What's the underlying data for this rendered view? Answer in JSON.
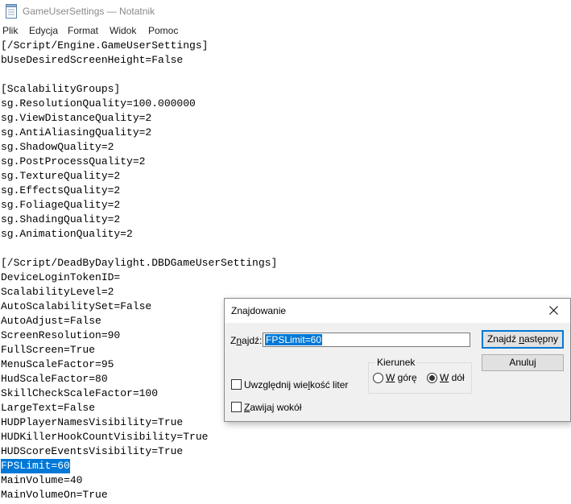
{
  "window": {
    "title": "GameUserSettings — Notatnik",
    "app_icon": "notepad-icon"
  },
  "menu": {
    "items": [
      "Plik",
      "Edycja",
      "Format",
      "Widok",
      "Pomoc"
    ]
  },
  "editor": {
    "lines": [
      "[/Script/Engine.GameUserSettings]",
      "bUseDesiredScreenHeight=False",
      "",
      "[ScalabilityGroups]",
      "sg.ResolutionQuality=100.000000",
      "sg.ViewDistanceQuality=2",
      "sg.AntiAliasingQuality=2",
      "sg.ShadowQuality=2",
      "sg.PostProcessQuality=2",
      "sg.TextureQuality=2",
      "sg.EffectsQuality=2",
      "sg.FoliageQuality=2",
      "sg.ShadingQuality=2",
      "sg.AnimationQuality=2",
      "",
      "[/Script/DeadByDaylight.DBDGameUserSettings]",
      "DeviceLoginTokenID=",
      "ScalabilityLevel=2",
      "AutoScalabilitySet=False",
      "AutoAdjust=False",
      "ScreenResolution=90",
      "FullScreen=True",
      "MenuScaleFactor=95",
      "HudScaleFactor=80",
      "SkillCheckScaleFactor=100",
      "LargeText=False",
      "HUDPlayerNamesVisibility=True",
      "HUDKillerHookCountVisibility=True",
      "HUDScoreEventsVisibility=True",
      "FPSLimit=60",
      "MainVolume=40",
      "MainVolumeOn=True"
    ],
    "selected_line_index": 29
  },
  "find_dialog": {
    "title": "Znajdowanie",
    "close_icon": "close-icon",
    "find_label_pre": "Z",
    "find_label_ul": "n",
    "find_label_post": "ajdź:",
    "find_value": "FPSLimit=60",
    "find_next_pre": "Znajdź ",
    "find_next_ul": "n",
    "find_next_post": "astępny",
    "cancel_label": "Anuluj",
    "direction_label": "Kierunek",
    "up_pre": "",
    "up_ul": "W",
    "up_post": " górę",
    "down_pre": "",
    "down_ul": "W",
    "down_post": " dół",
    "direction_selected": "down",
    "match_case_pre": "Uwzględnij wie",
    "match_case_ul": "l",
    "match_case_post": "kość liter",
    "match_case_checked": false,
    "wrap_pre": "",
    "wrap_ul": "Z",
    "wrap_post": "awijaj wokół",
    "wrap_checked": false
  }
}
